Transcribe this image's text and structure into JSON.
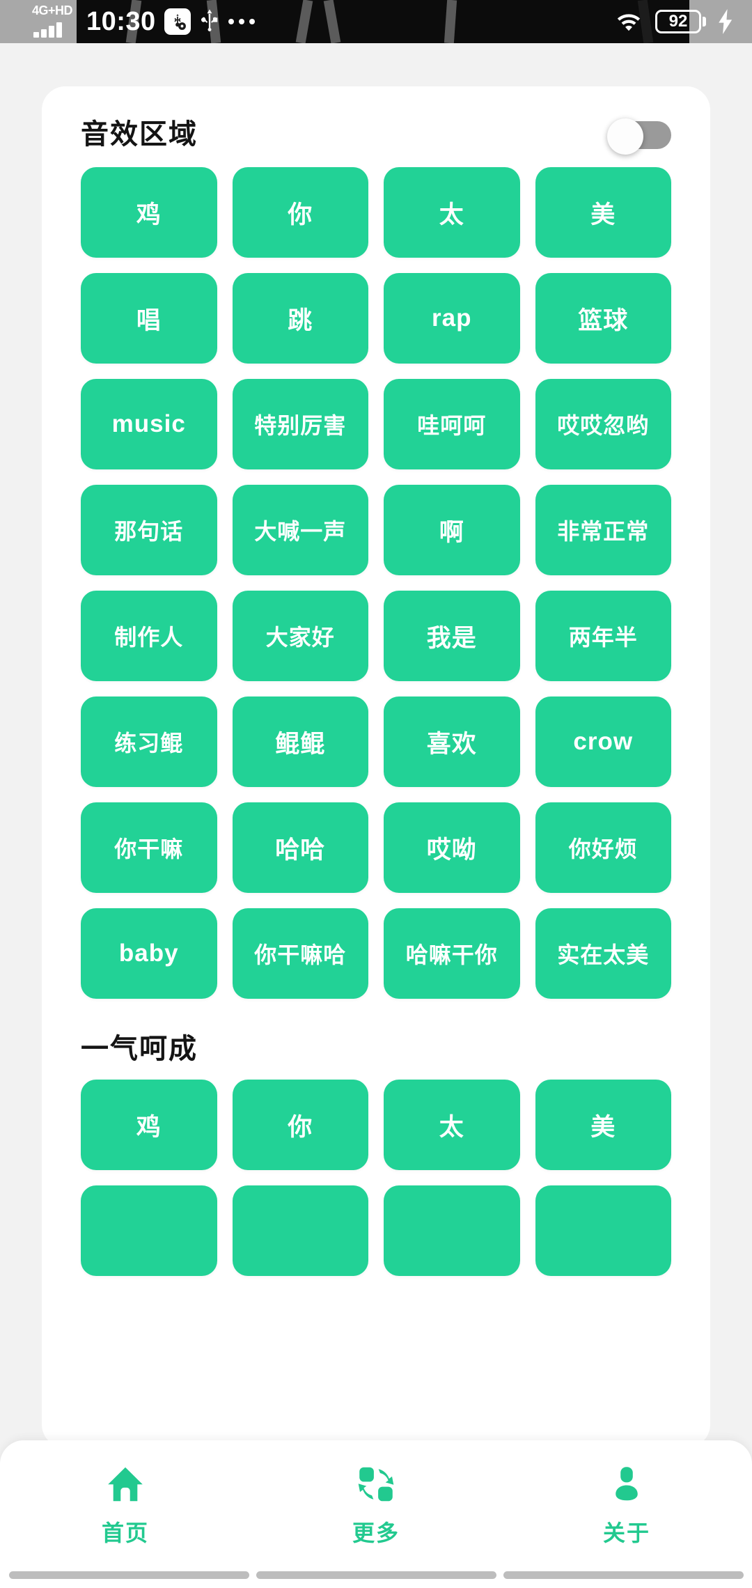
{
  "status_bar": {
    "network_label": "4G+HD",
    "time": "10:30",
    "icons": [
      "usb-debug-icon",
      "usb-icon",
      "overflow-dots-icon",
      "wifi-icon",
      "battery-icon",
      "charging-bolt-icon"
    ],
    "battery_level": "92"
  },
  "sections": [
    {
      "title": "音效区域",
      "toggle": {
        "state": "off"
      },
      "buttons": [
        "鸡",
        "你",
        "太",
        "美",
        "唱",
        "跳",
        "rap",
        "篮球",
        "music",
        "特别厉害",
        "哇呵呵",
        "哎哎忽哟",
        "那句话",
        "大喊一声",
        "啊",
        "非常正常",
        "制作人",
        "大家好",
        "我是",
        "两年半",
        "练习鲲",
        "鲲鲲",
        "喜欢",
        "crow",
        "你干嘛",
        "哈哈",
        "哎呦",
        "你好烦",
        "baby",
        "你干嘛哈",
        "哈嘛干你",
        "实在太美"
      ]
    },
    {
      "title": "一气呵成",
      "buttons": [
        "鸡",
        "你",
        "太",
        "美",
        "",
        "",
        "",
        ""
      ]
    }
  ],
  "bottom_nav": {
    "items": [
      {
        "label": "首页",
        "icon": "home-icon"
      },
      {
        "label": "更多",
        "icon": "swap-icon"
      },
      {
        "label": "关于",
        "icon": "person-icon"
      }
    ],
    "active_color": "#22c98f"
  },
  "theme": {
    "accent_green": "#22d296",
    "page_background": "#f2f2f2",
    "card_background": "#ffffff",
    "toggle_off_track": "#9a9a9a"
  }
}
